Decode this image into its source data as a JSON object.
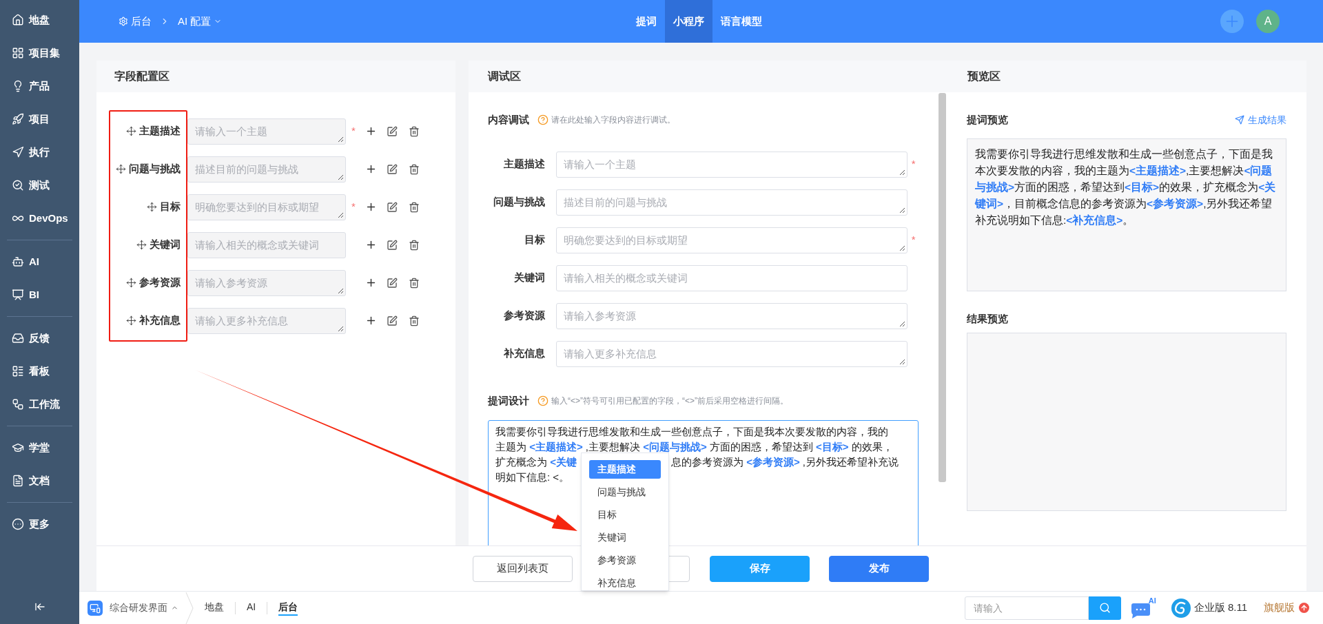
{
  "sidebar": {
    "groups": [
      [
        {
          "label": "地盘"
        },
        {
          "label": "项目集"
        },
        {
          "label": "产品"
        },
        {
          "label": "项目"
        },
        {
          "label": "执行"
        },
        {
          "label": "测试"
        },
        {
          "label": "DevOps"
        }
      ],
      [
        {
          "label": "AI"
        },
        {
          "label": "BI"
        }
      ],
      [
        {
          "label": "反馈"
        },
        {
          "label": "看板"
        },
        {
          "label": "工作流"
        }
      ],
      [
        {
          "label": "学堂"
        },
        {
          "label": "文档"
        }
      ],
      [
        {
          "label": "更多"
        }
      ]
    ]
  },
  "top_bar": {
    "breadcrumb": [
      "后台",
      "AI 配置"
    ],
    "tabs": [
      {
        "label": "提词",
        "selected": false
      },
      {
        "label": "小程序",
        "selected": true
      },
      {
        "label": "语言模型",
        "selected": false
      }
    ],
    "avatar": "A"
  },
  "field_config": {
    "title": "字段配置区",
    "fields": [
      {
        "label": "主题描述",
        "placeholder": "请输入一个主题",
        "required_mark": "*",
        "resizable": true
      },
      {
        "label": "问题与挑战",
        "placeholder": "描述目前的问题与挑战",
        "resizable": true
      },
      {
        "label": "目标",
        "placeholder": "明确您要达到的目标或期望",
        "required_mark": "*",
        "resizable": true
      },
      {
        "label": "关键词",
        "placeholder": "请输入相关的概念或关键词",
        "resizable": false
      },
      {
        "label": "参考资源",
        "placeholder": "请输入参考资源",
        "resizable": true
      },
      {
        "label": "补充信息",
        "placeholder": "请输入更多补充信息",
        "resizable": true
      }
    ]
  },
  "debug": {
    "title": "调试区",
    "content_section": {
      "title": "内容调试",
      "hint": "请在此处输入字段内容进行调试。",
      "fields": [
        {
          "label": "主题描述",
          "placeholder": "请输入一个主题",
          "required_mark": "*",
          "resizable": true
        },
        {
          "label": "问题与挑战",
          "placeholder": "描述目前的问题与挑战",
          "resizable": true
        },
        {
          "label": "目标",
          "placeholder": "明确您要达到的目标或期望",
          "required_mark": "*",
          "resizable": true
        },
        {
          "label": "关键词",
          "placeholder": "请输入相关的概念或关键词",
          "resizable": false
        },
        {
          "label": "参考资源",
          "placeholder": "请输入参考资源",
          "resizable": true
        },
        {
          "label": "补充信息",
          "placeholder": "请输入更多补充信息",
          "resizable": true
        }
      ]
    },
    "prompt_section": {
      "title": "提词设计",
      "hint": "输入“<>”符号可引用已配置的字段，“<>”前后采用空格进行间隔。",
      "lines": [
        {
          "text": "我需要你引导我进行思维发散和生成一些创意点子，下面是我本次要发散的内容，我的"
        },
        {
          "text": "主题为 **<主题描述>** ,主要想解决 **<问题与挑战>** 方面的困惑，希望达到 **<目标>** 的效果，"
        },
        {
          "text": "扩充概念为 **<关键**",
          "text_after_menu": "息的参考资源为 **<参考资源>** ,另外我还希望补充说"
        },
        {
          "text": "明如下信息: <。"
        }
      ],
      "suggestions": [
        {
          "label": "主题描述",
          "selected": true
        },
        {
          "label": "问题与挑战",
          "selected": false
        },
        {
          "label": "目标",
          "selected": false
        },
        {
          "label": "关键词",
          "selected": false
        },
        {
          "label": "参考资源",
          "selected": false
        },
        {
          "label": "补充信息",
          "selected": false
        }
      ]
    }
  },
  "preview": {
    "title": "预览区",
    "prompt_preview": {
      "title": "提词预览",
      "action": "生成结果",
      "text": "我需要你引导我进行思维发散和生成一些创意点子，下面是我本次要发散的内容，我的主题为**<主题描述>**,主要想解决**<问题与挑战>**方面的困惑，希望达到**<目标>**的效果，扩充概念为**<关键词>**，目前概念信息的参考资源为**<参考资源>**,另外我还希望补充说明如下信息:**<补充信息>**。"
    },
    "result_preview": {
      "title": "结果预览"
    }
  },
  "footer_buttons": [
    {
      "label": "返回列表页",
      "kind": "default"
    },
    {
      "kind": "default"
    },
    {
      "label": "保存",
      "kind": "save"
    },
    {
      "label": "发布",
      "kind": "primary"
    }
  ],
  "bottom_bar": {
    "workspace": "综合研发界面",
    "crumbs": [
      {
        "label": "地盘",
        "selected": false
      },
      {
        "label": "AI",
        "selected": false
      },
      {
        "label": "后台",
        "selected": true
      }
    ],
    "search": {
      "placeholder": "请输入"
    },
    "ai_badge": "AI",
    "version": "企业版 8.11",
    "edition": "旗舰版"
  }
}
